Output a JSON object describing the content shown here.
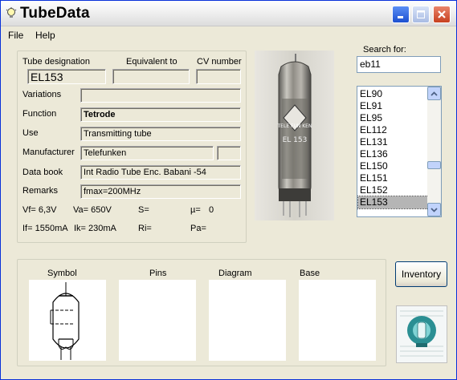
{
  "window": {
    "title": "TubeData"
  },
  "menu": {
    "file": "File",
    "help": "Help"
  },
  "labels": {
    "tube_designation": "Tube designation",
    "equivalent_to": "Equivalent to",
    "cv_number": "CV number",
    "variations": "Variations",
    "function": "Function",
    "use": "Use",
    "manufacturer": "Manufacturer",
    "data_book": "Data book",
    "remarks": "Remarks",
    "search_for": "Search for:"
  },
  "values": {
    "tube_designation": "EL153",
    "equivalent_to": "",
    "cv_number": "",
    "variations": "",
    "function": "Tetrode",
    "use": "Transmitting tube",
    "manufacturer": "Telefunken",
    "manufacturer_extra": "",
    "data_book": "Int Radio Tube Enc. Babani -54",
    "remarks": "fmax=200MHz"
  },
  "specs": {
    "vf": "Vf= 6,3V",
    "va": "Va= 650V",
    "s": "S=",
    "mu": "µ=",
    "mu_value": "0",
    "if": "If= 1550mA",
    "ik": "Ik= 230mA",
    "ri": "Ri=",
    "pa": "Pa="
  },
  "search": {
    "value": "eb11"
  },
  "tube_list": [
    "EL90",
    "EL91",
    "EL95",
    "EL112",
    "EL131",
    "EL136",
    "EL150",
    "EL151",
    "EL152",
    "EL153"
  ],
  "selected_tube": "EL153",
  "photo_marking": {
    "brand": "TELE FUN KEN",
    "model": "EL 153"
  },
  "panels": {
    "symbol": "Symbol",
    "pins": "Pins",
    "diagram": "Diagram",
    "base": "Base"
  },
  "buttons": {
    "inventory": "Inventory"
  },
  "colors": {
    "selection": "#b5b5b5",
    "title_bar": "#e6e6e6",
    "close_button": "#d2502e"
  }
}
